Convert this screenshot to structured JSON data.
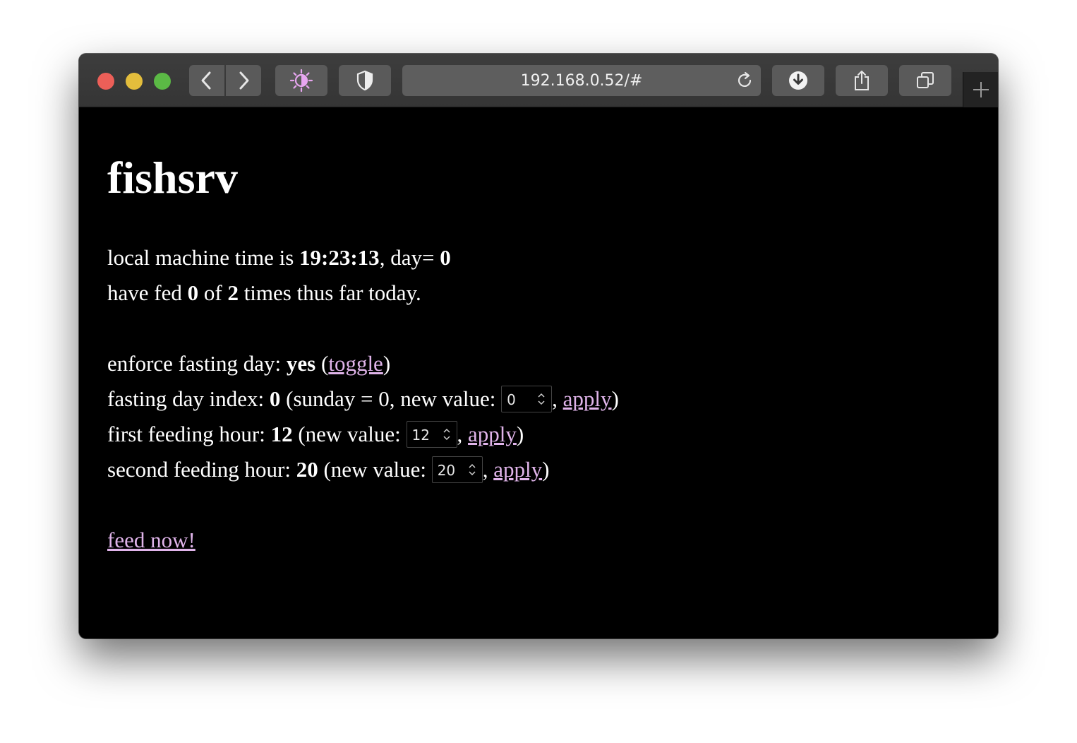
{
  "browser": {
    "address": "192.168.0.52/#",
    "icons": [
      "close-light",
      "minimize-light",
      "maximize-light",
      "back-icon",
      "forward-icon",
      "appearance-icon",
      "shield-icon",
      "reload-icon",
      "download-icon",
      "share-icon",
      "tabs-icon",
      "new-tab-icon"
    ],
    "colors": {
      "accent_icon": "#e7a6f0",
      "toolbar": "#3a3a3a"
    }
  },
  "page": {
    "title": "fishsrv",
    "time_line": {
      "prefix": "local machine time is ",
      "time": "19:23:13",
      "mid": ", day= ",
      "day": "0"
    },
    "fed_line": {
      "prefix": "have fed ",
      "fed": "0",
      "mid": " of ",
      "total": "2",
      "suffix": " times thus far today."
    },
    "fasting_line": {
      "prefix": "enforce fasting day: ",
      "value": "yes",
      "open": " (",
      "link": "toggle",
      "close": ")"
    },
    "fasting_index_line": {
      "prefix": "fasting day index: ",
      "value": "0",
      "mid": " (sunday = 0, new value: ",
      "input_value": "0",
      "comma": ", ",
      "link": "apply",
      "close": ")"
    },
    "first_hour_line": {
      "prefix": "first feeding hour: ",
      "value": "12",
      "mid": " (new value: ",
      "input_value": "12",
      "comma": ", ",
      "link": "apply",
      "close": ")"
    },
    "second_hour_line": {
      "prefix": "second feeding hour: ",
      "value": "20",
      "mid": " (new value: ",
      "input_value": "20",
      "comma": ", ",
      "link": "apply",
      "close": ")"
    },
    "feed_link": "feed now!",
    "colors": {
      "link": "#e0b4ea",
      "background": "#000000",
      "text": "#ffffff"
    }
  }
}
